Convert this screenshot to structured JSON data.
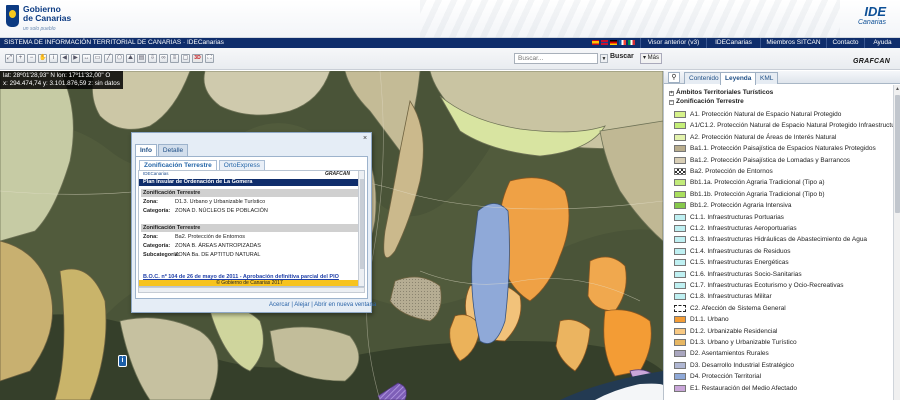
{
  "header": {
    "gov_name_line1": "Gobierno",
    "gov_name_line2": "de Canarias",
    "gov_slogan": "un solo pueblo",
    "ide_logo": "IDE",
    "ide_logo_sub": "Canarias"
  },
  "nav": {
    "title": "SISTEMA DE INFORMACIÓN TERRITORIAL DE CANARIAS · IDECanarias",
    "links": [
      "Visor anterior (v3)",
      "IDECanarias",
      "Miembros SITCAN",
      "Contacto",
      "Ayuda"
    ]
  },
  "toolbar": {
    "search_placeholder": "Buscar...",
    "search_button": "Buscar",
    "more_button": "Más",
    "tool_3d": "3D",
    "brand": "GRAFCAN"
  },
  "coords": {
    "line1": "lat: 28º01'28,93\" N  lon: 17º11'32,00\" O",
    "line2": "x: 294.474,74  y: 3.101.876,59  z: sin datos"
  },
  "popup": {
    "tabs": [
      "Info",
      "Detalle"
    ],
    "subtabs": [
      "Zonificación Terrestre",
      "OrtoExpress"
    ],
    "frame_org": "IDECanarias",
    "frame_brand": "GRAFCAN",
    "plan_title": "Plan Insular de Ordenación de La Gomera",
    "sections": [
      {
        "heading": "Zonificación Terrestre",
        "rows": [
          {
            "label": "Zona:",
            "value": "D1.3. Urbano y Urbanizable Turístico"
          },
          {
            "label": "Categoría:",
            "value": "ZONA D. NÚCLEOS DE POBLACIÓN"
          }
        ]
      },
      {
        "heading": "Zonificación Terrestre",
        "rows": [
          {
            "label": "Zona:",
            "value": "Ba2. Protección de Entornos"
          },
          {
            "label": "Categoría:",
            "value": "ZONA B. ÁREAS ANTROPIZADAS"
          },
          {
            "label": "Subcategoría:",
            "value": "ZONA Ba. DE APTITUD NATURAL"
          }
        ]
      }
    ],
    "boc_link": "B.O.C. nº 104 de 26 de mayo de 2011 - Aprobación definitiva parcial del PIO",
    "copyright": "© Gobierno de Canarias 2017",
    "footer": "Acercar | Alejar | Abrir en nueva ventana"
  },
  "panel": {
    "tabs": [
      "Contenido",
      "Leyenda",
      "KML"
    ],
    "active_tab": "Leyenda",
    "tree_nodes": [
      "Ámbitos Territoriales Turísticos",
      "Zonificación Terrestre"
    ],
    "legend": [
      {
        "label": "A1. Protección Natural de Espacio Natural Protegido",
        "color": "#d6f28a"
      },
      {
        "label": "A1/C1.2. Protección Natural de Espacio Natural Protegido  Infraestructura",
        "color": "#c4ee78"
      },
      {
        "label": "A2. Protección Natural de Áreas de Interés Natural",
        "color": "#e3f3ad"
      },
      {
        "label": "Ba1.1. Protección Paisajística de Espacios Naturales Protegidos",
        "color": "#b9ad8d"
      },
      {
        "label": "Ba1.2. Protección Paisajística de Lomadas y Barrancos",
        "color": "#d9cfb6"
      },
      {
        "label": "Ba2. Protección de Entornos",
        "color": "#ffffff",
        "pattern": "checker"
      },
      {
        "label": "Bb1.1a. Protección Agraria Tradicional (Tipo a)",
        "color": "#c2eb7a"
      },
      {
        "label": "Bb1.1b. Protección Agraria Tradicional (Tipo b)",
        "color": "#a9de5d"
      },
      {
        "label": "Bb1.2. Protección Agraria Intensiva",
        "color": "#86c84b"
      },
      {
        "label": "C1.1. Infraestructuras Portuarias",
        "color": "#bff0f2"
      },
      {
        "label": "C1.2. Infraestructuras Aeroportuarias",
        "color": "#bff0f2"
      },
      {
        "label": "C1.3. Infraestructuras Hidráulicas de Abastecimiento de Agua",
        "color": "#bff0f2"
      },
      {
        "label": "C1.4. Infraestructuras de Residuos",
        "color": "#bff0f2"
      },
      {
        "label": "C1.5. Infraestructuras Energéticas",
        "color": "#bff0f2"
      },
      {
        "label": "C1.6. Infraestructuras Socio-Sanitarias",
        "color": "#bff0f2"
      },
      {
        "label": "C1.7. Infraestructuras Ecoturismo y Ocio-Recreativas",
        "color": "#bff0f2"
      },
      {
        "label": "C1.8. Infraestructuras Militar",
        "color": "#bff0f2"
      },
      {
        "label": "C2. Afección de Sistema General",
        "color": "#ffffff",
        "pattern": "dashed"
      },
      {
        "label": "D1.1. Urbano",
        "color": "#f39c35"
      },
      {
        "label": "D1.2. Urbanizable Residencial",
        "color": "#f8c983"
      },
      {
        "label": "D1.3. Urbano y Urbanizable Turístico",
        "color": "#e7b763"
      },
      {
        "label": "D2. Asentamientos Rurales",
        "color": "#a9a6bf"
      },
      {
        "label": "D3. Desarrollo Industrial Estratégico",
        "color": "#b0b7d3"
      },
      {
        "label": "D4. Protección Territorial",
        "color": "#8fa9d8"
      },
      {
        "label": "E1. Restauración del Medio Afectado",
        "color": "#c9a6d9"
      }
    ]
  },
  "colors": {
    "navbar": "#0f2d6b",
    "accent_blue": "#1f4f86",
    "copyright_bar": "#f7c31e"
  }
}
